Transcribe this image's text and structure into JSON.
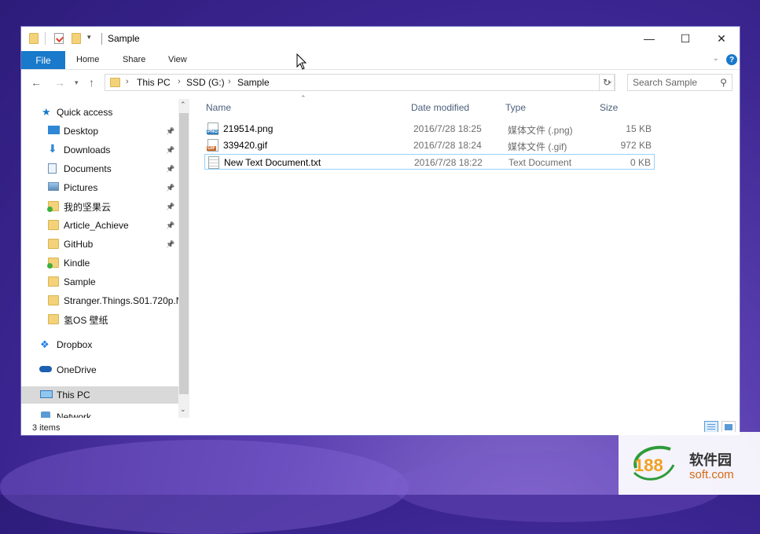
{
  "window": {
    "title": "Sample",
    "controls": {
      "minimize": "—",
      "maximize": "☐",
      "close": "✕"
    }
  },
  "ribbon": {
    "file_tab": "File",
    "tabs": [
      "Home",
      "Share",
      "View"
    ],
    "help": "?"
  },
  "address": {
    "crumbs": [
      "This PC",
      "SSD (G:)",
      "Sample"
    ],
    "search_placeholder": "Search Sample"
  },
  "nav": {
    "quick_access": "Quick access",
    "items": [
      {
        "label": "Desktop",
        "icon": "desktop-icon",
        "pinned": true
      },
      {
        "label": "Downloads",
        "icon": "downloads-icon",
        "pinned": true
      },
      {
        "label": "Documents",
        "icon": "documents-icon",
        "pinned": true
      },
      {
        "label": "Pictures",
        "icon": "pictures-icon",
        "pinned": true
      },
      {
        "label": "我的坚果云",
        "icon": "synced-folder-icon",
        "pinned": true
      },
      {
        "label": "Article_Achieve",
        "icon": "folder-icon",
        "pinned": true
      },
      {
        "label": "GitHub",
        "icon": "folder-icon",
        "pinned": true
      },
      {
        "label": "Kindle",
        "icon": "synced-folder-icon",
        "pinned": false
      },
      {
        "label": "Sample",
        "icon": "folder-icon",
        "pinned": false
      },
      {
        "label": "Stranger.Things.S01.720p.N",
        "icon": "folder-icon",
        "pinned": false
      },
      {
        "label": "氢OS 壁纸",
        "icon": "folder-icon",
        "pinned": false
      }
    ],
    "dropbox": "Dropbox",
    "onedrive": "OneDrive",
    "this_pc": "This PC",
    "network": "Network"
  },
  "columns": {
    "name": "Name",
    "date": "Date modified",
    "type": "Type",
    "size": "Size"
  },
  "files": [
    {
      "name": "219514.png",
      "date": "2016/7/28 18:25",
      "type": "媒体文件 (.png)",
      "size": "15 KB",
      "tag": "PNG",
      "tag_color": "#2f7fbf"
    },
    {
      "name": "339420.gif",
      "date": "2016/7/28 18:24",
      "type": "媒体文件 (.gif)",
      "size": "972 KB",
      "tag": "GIF",
      "tag_color": "#c8692a"
    },
    {
      "name": "New Text Document.txt",
      "date": "2016/7/28 18:22",
      "type": "Text Document",
      "size": "0 KB",
      "tag": "",
      "tag_color": "#ffffff"
    }
  ],
  "status": {
    "item_count": "3 items"
  },
  "watermark": {
    "number": "188",
    "brand_cn": "软件园",
    "brand_en": "soft.com"
  },
  "colors": {
    "accent": "#1979ca",
    "selection_border": "#99d1ff",
    "header_text": "#4c607a"
  }
}
